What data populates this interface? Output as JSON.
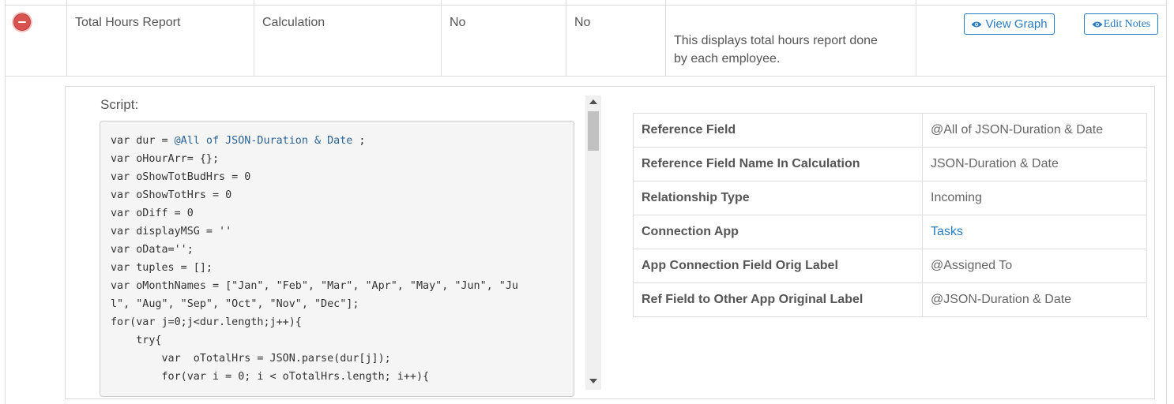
{
  "row": {
    "name": "Total Hours Report",
    "type": "Calculation",
    "col3": "No",
    "col4": "No",
    "description_line1": "This displays total hours report done",
    "description_line2": "by each employee.",
    "view_graph_label": "View Graph",
    "edit_notes_label": "Edit Notes",
    "accent_color": "#2a7bbf",
    "remove_color": "#d9534f"
  },
  "script": {
    "label": "Script:",
    "lines": [
      {
        "pre": "var dur = ",
        "ref": "@All of JSON-Duration & Date",
        "post": " ;"
      },
      {
        "pre": "var oHourArr= {};"
      },
      {
        "pre": "var oShowTotBudHrs = 0"
      },
      {
        "pre": "var oShowTotHrs = 0"
      },
      {
        "pre": "var oDiff = 0"
      },
      {
        "pre": "var displayMSG = ''"
      },
      {
        "pre": "var oData='';"
      },
      {
        "pre": "var tuples = [];"
      },
      {
        "pre": "var oMonthNames = [\"Jan\", \"Feb\", \"Mar\", \"Apr\", \"May\", \"Jun\", \"Ju"
      },
      {
        "pre": "l\", \"Aug\", \"Sep\", \"Oct\", \"Nov\", \"Dec\"];"
      },
      {
        "pre": "for(var j=0;j<dur.length;j++){"
      },
      {
        "pre": "    try{"
      },
      {
        "pre": "        var  oTotalHrs = JSON.parse(dur[j]);"
      },
      {
        "pre": "        for(var i = 0; i < oTotalHrs.length; i++){"
      }
    ]
  },
  "details": [
    {
      "key": "Reference Field",
      "value": "@All of JSON-Duration & Date"
    },
    {
      "key": "Reference Field Name In Calculation",
      "value": "JSON-Duration & Date"
    },
    {
      "key": "Relationship Type",
      "value": "Incoming"
    },
    {
      "key": "Connection App",
      "value": "Tasks",
      "link": true
    },
    {
      "key": "App Connection Field Orig Label",
      "value": "@Assigned To"
    },
    {
      "key": "Ref Field to Other App Original Label",
      "value": "@JSON-Duration & Date"
    }
  ]
}
